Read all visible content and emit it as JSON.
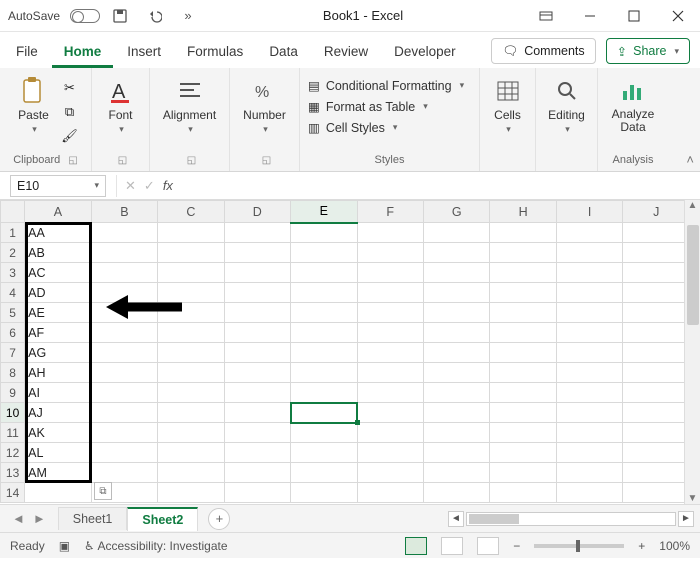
{
  "titlebar": {
    "autosave": "AutoSave",
    "title": "Book1 - Excel"
  },
  "tabs": {
    "file": "File",
    "home": "Home",
    "insert": "Insert",
    "formulas": "Formulas",
    "data": "Data",
    "review": "Review",
    "developer": "Developer",
    "comments": "Comments",
    "share": "Share"
  },
  "ribbon": {
    "paste": "Paste",
    "clipboard": "Clipboard",
    "font": "Font",
    "alignment": "Alignment",
    "number": "Number",
    "cond_format": "Conditional Formatting",
    "format_table": "Format as Table",
    "cell_styles": "Cell Styles",
    "styles": "Styles",
    "cells": "Cells",
    "editing": "Editing",
    "analyze": "Analyze Data",
    "analysis": "Analysis"
  },
  "fxbar": {
    "namebox": "E10",
    "fx": "fx"
  },
  "grid": {
    "cols": [
      "A",
      "B",
      "C",
      "D",
      "E",
      "F",
      "G",
      "H",
      "I",
      "J"
    ],
    "rows": [
      "1",
      "2",
      "3",
      "4",
      "5",
      "6",
      "7",
      "8",
      "9",
      "10",
      "11",
      "12",
      "13",
      "14"
    ],
    "colA": [
      "AA",
      "AB",
      "AC",
      "AD",
      "AE",
      "AF",
      "AG",
      "AH",
      "AI",
      "AJ",
      "AK",
      "AL",
      "AM",
      ""
    ],
    "selected_col": "E",
    "selected_row": "10"
  },
  "sheets": {
    "s1": "Sheet1",
    "s2": "Sheet2"
  },
  "status": {
    "ready": "Ready",
    "access": "Accessibility: Investigate",
    "zoom": "100%"
  }
}
